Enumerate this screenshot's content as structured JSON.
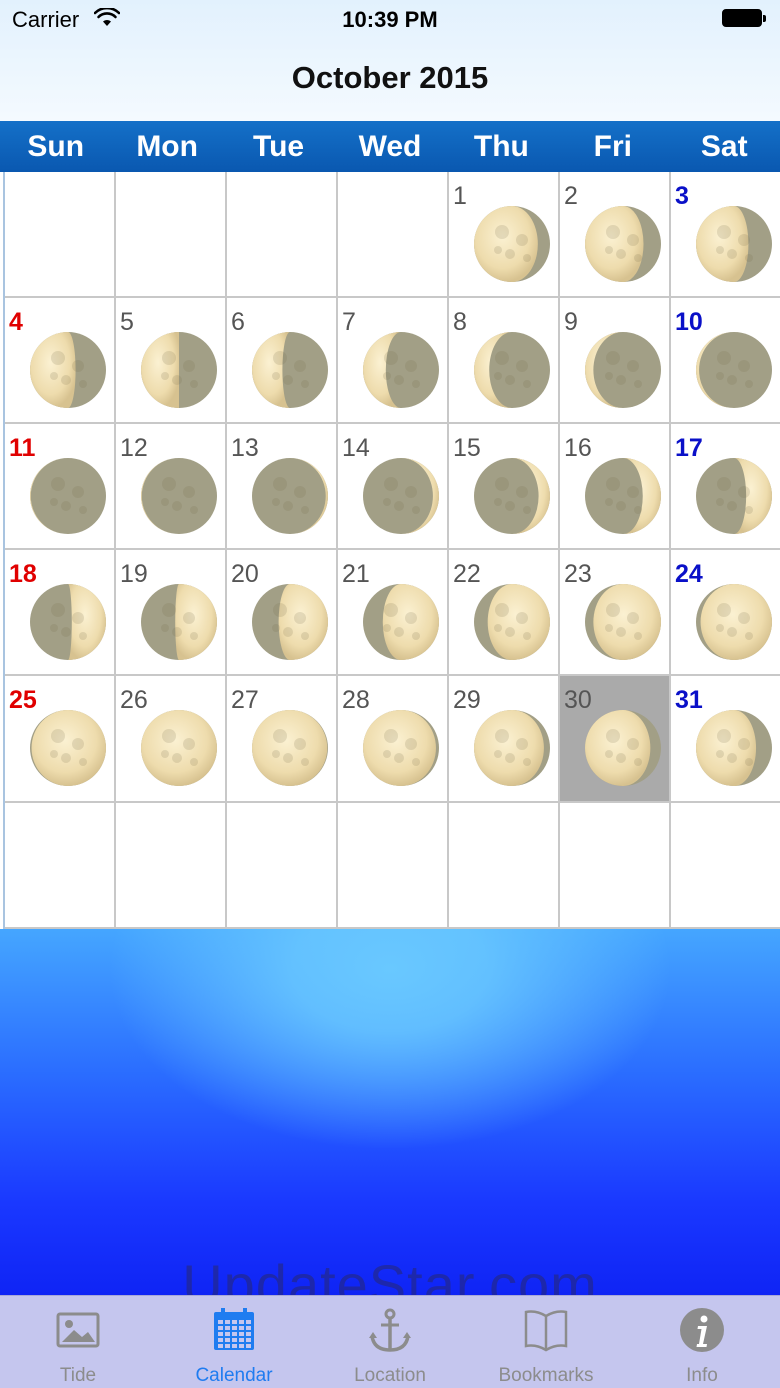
{
  "status_bar": {
    "carrier": "Carrier",
    "time": "10:39 PM"
  },
  "header": {
    "title": "October 2015"
  },
  "weekdays": [
    "Sun",
    "Mon",
    "Tue",
    "Wed",
    "Thu",
    "Fri",
    "Sat"
  ],
  "calendar": {
    "first_weekday_index": 4,
    "days_in_month": 31,
    "total_rows": 6,
    "selected_day": 30,
    "moon_illumination_percent": [
      84,
      77,
      69,
      60,
      50,
      40,
      30,
      20,
      11,
      4,
      1,
      1,
      3,
      8,
      15,
      24,
      34,
      45,
      55,
      65,
      74,
      82,
      89,
      94,
      98,
      100,
      99,
      96,
      92,
      86,
      79
    ],
    "moon_waxing": [
      false,
      false,
      false,
      false,
      false,
      false,
      false,
      false,
      false,
      false,
      false,
      false,
      true,
      true,
      true,
      true,
      true,
      true,
      true,
      true,
      true,
      true,
      true,
      true,
      true,
      true,
      false,
      false,
      false,
      false,
      false
    ]
  },
  "watermark": "UpdateStar.com",
  "tabs": [
    {
      "label": "Tide",
      "icon": "photo-icon",
      "active": false
    },
    {
      "label": "Calendar",
      "icon": "calendar-icon",
      "active": true
    },
    {
      "label": "Location",
      "icon": "anchor-icon",
      "active": false
    },
    {
      "label": "Bookmarks",
      "icon": "book-icon",
      "active": false
    },
    {
      "label": "Info",
      "icon": "info-icon",
      "active": false
    }
  ],
  "colors": {
    "header_bar": "#0a58b0",
    "sunday_text": "#e00000",
    "saturday_text": "#0a10c8",
    "selected_cell": "#aaaaaa",
    "tab_active": "#1f7cf0",
    "tab_inactive": "#8c8c8c"
  }
}
